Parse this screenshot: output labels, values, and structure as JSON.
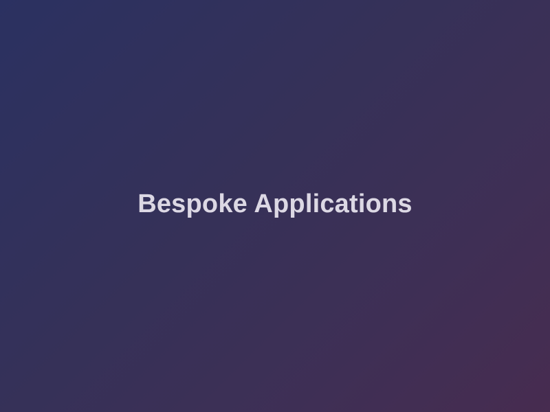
{
  "splash": {
    "title": "Bespoke Applications"
  },
  "colors": {
    "background_start": "#2b3161",
    "background_end": "#472c50",
    "title_text": "#dcd8e4"
  }
}
